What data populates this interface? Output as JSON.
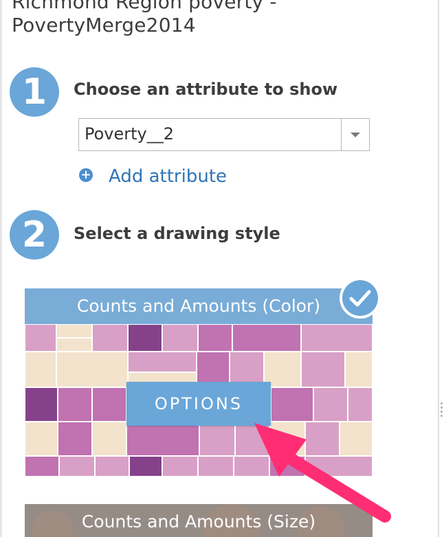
{
  "layer": {
    "title": "Richmond Region poverty - PovertyMerge2014"
  },
  "steps": [
    {
      "number": "1",
      "label": "Choose an attribute to show"
    },
    {
      "number": "2",
      "label": "Select a drawing style"
    }
  ],
  "attribute_select": {
    "value": "Poverty__2"
  },
  "add_attribute": {
    "label": "Add attribute"
  },
  "styles": [
    {
      "title": "Counts and Amounts (Color)",
      "selected": true,
      "options_label": "OPTIONS"
    },
    {
      "title": "Counts and Amounts (Size)"
    }
  ],
  "colors": {
    "accent": "#6aa6d8",
    "link": "#2f74b5",
    "callout_arrow": "#ff2e74"
  }
}
